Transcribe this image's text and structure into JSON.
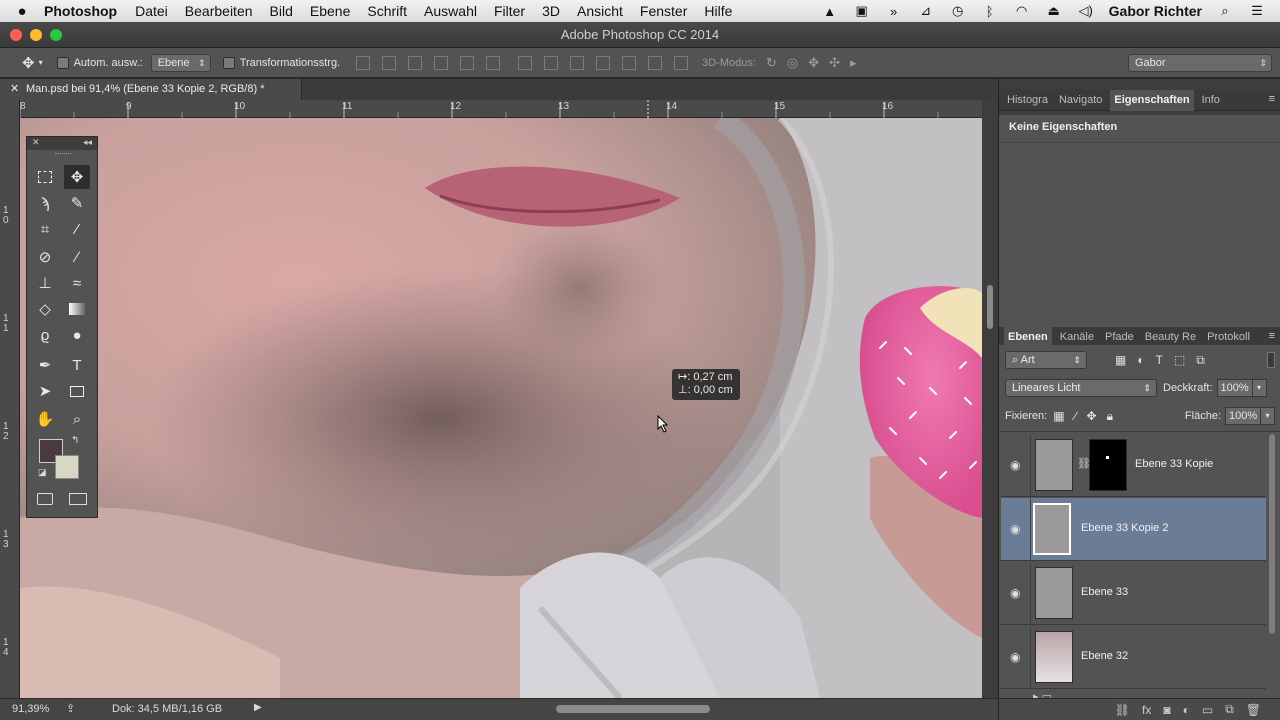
{
  "menubar": {
    "app": "Photoshop",
    "items": [
      "Datei",
      "Bearbeiten",
      "Bild",
      "Ebene",
      "Schrift",
      "Auswahl",
      "Filter",
      "3D",
      "Ansicht",
      "Fenster",
      "Hilfe"
    ],
    "user": "Gabor Richter"
  },
  "window": {
    "title": "Adobe Photoshop CC 2014"
  },
  "options": {
    "auto_select_label": "Autom. ausw.:",
    "auto_select_value": "Ebene",
    "transform_label": "Transformationsstrg.",
    "mode3d_label": "3D-Modus:",
    "workspace": "Gabor"
  },
  "document": {
    "tab_title": "Man.psd bei 91,4% (Ebene 33 Kopie 2, RGB/8) *"
  },
  "ruler": {
    "h_labels": [
      "8",
      "9",
      "10",
      "11",
      "12",
      "13",
      "14",
      "15",
      "16"
    ],
    "v_labels": [
      "1\n0",
      "1\n1",
      "1\n2",
      "1\n3",
      "1\n4"
    ]
  },
  "measure": {
    "dx": "↦: 0,27 cm",
    "dy": "⊥: 0,00 cm"
  },
  "status": {
    "zoom": "91,39%",
    "doc": "Dok: 34,5 MB/1,16 GB"
  },
  "panels": {
    "top_tabs": [
      "Histogra",
      "Navigato",
      "Eigenschaften",
      "Info"
    ],
    "top_active": "Eigenschaften",
    "properties_empty": "Keine Eigenschaften",
    "layer_tabs": [
      "Ebenen",
      "Kanäle",
      "Pfade",
      "Beauty Re",
      "Protokoll"
    ],
    "layer_tab_active": "Ebenen",
    "filter_kind": "Art",
    "blend_mode": "Lineares Licht",
    "opacity_label": "Deckkraft:",
    "opacity_value": "100%",
    "lock_label": "Fixieren:",
    "fill_label": "Fläche:",
    "fill_value": "100%"
  },
  "layers": [
    {
      "name": "Ebene 33 Kopie",
      "has_mask": true,
      "selected": false
    },
    {
      "name": "Ebene 33 Kopie 2",
      "has_mask": false,
      "selected": true
    },
    {
      "name": "Ebene 33",
      "has_mask": false,
      "selected": false
    },
    {
      "name": "Ebene 32",
      "has_mask": false,
      "selected": false
    }
  ],
  "colors": {
    "foreground": "#4a3a40",
    "background": "#d8d6c4",
    "selection": "#6b7c97"
  }
}
